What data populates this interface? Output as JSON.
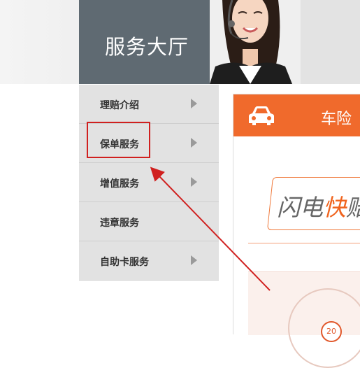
{
  "banner": {
    "title": "服务大厅"
  },
  "sidebar": {
    "items": [
      {
        "label": "理赔介绍",
        "has_arrow": true
      },
      {
        "label": "保单服务",
        "has_arrow": true
      },
      {
        "label": "增值服务",
        "has_arrow": true
      },
      {
        "label": "违章服务",
        "has_arrow": false
      },
      {
        "label": "自助卡服务",
        "has_arrow": true
      }
    ],
    "highlighted_item": "保单服务"
  },
  "panel": {
    "title": "车险",
    "header_icon": "car-icon",
    "promo": {
      "prefix": "闪电",
      "accent": "快",
      "suffix": "赔"
    },
    "stamp_value": "20"
  },
  "colors": {
    "brand_orange": "#f06a2c",
    "banner_gray": "#5f6a72",
    "menu_gray": "#e2e2e2",
    "annotation_red": "#d0201f"
  }
}
